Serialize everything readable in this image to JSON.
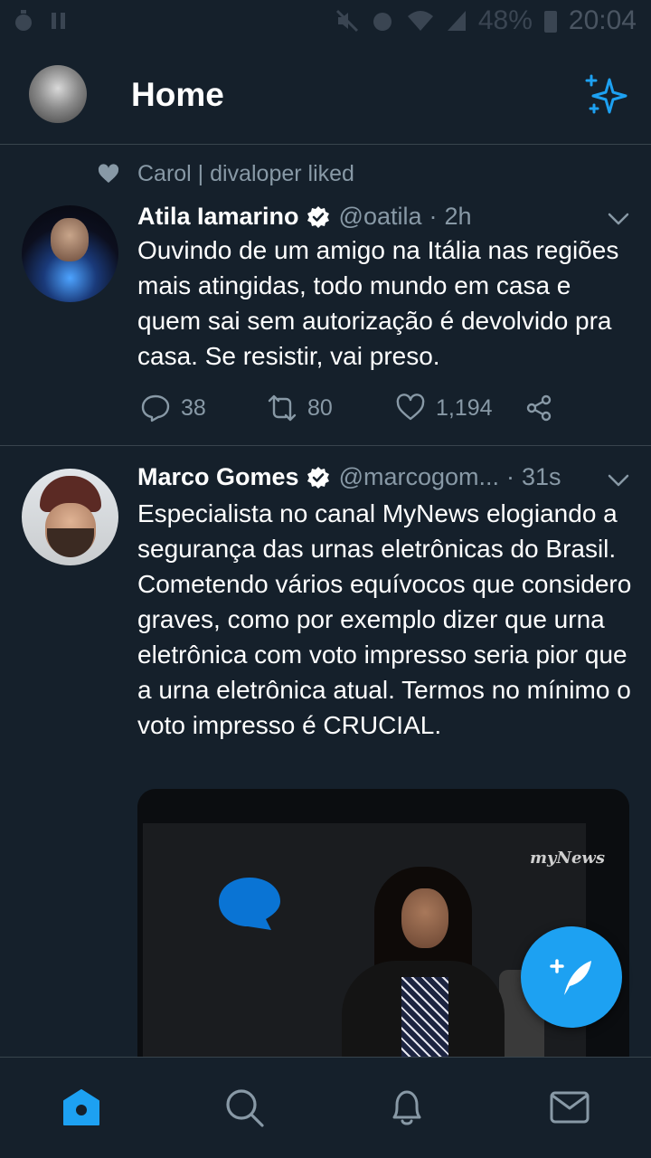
{
  "status_bar": {
    "battery": "48%",
    "time": "20:04"
  },
  "header": {
    "title": "Home",
    "icons": [
      "avatar",
      "sparkle-icon"
    ]
  },
  "tweets": [
    {
      "social_context": "Carol | divaloper liked",
      "name": "Atila Iamarino",
      "verified": true,
      "handle": "@oatila",
      "separator": "·",
      "time": "2h",
      "text": "Ouvindo de um amigo na Itália nas regiões mais atingidas, todo mundo em casa e quem sai sem autorização é devolvido pra casa. Se resistir, vai preso.",
      "reply_count": "38",
      "retweet_count": "80",
      "like_count": "1,194"
    },
    {
      "name": "Marco Gomes",
      "verified": true,
      "handle": "@marcogom...",
      "separator": "·",
      "time": "31s",
      "text": "Especialista no canal MyNews elogiando a segurança das urnas eletrônicas do Brasil. Cometendo vários equívocos que considero graves, como por exemplo dizer que urna eletrônica com voto impresso seria pior que a urna eletrônica atual. Termos no mínimo o voto impresso é CRUCIAL.",
      "media_logo": "myNews"
    }
  ],
  "colors": {
    "background": "#15202b",
    "accent": "#1da1f2",
    "secondary_text": "#8899a6",
    "divider": "#38444d"
  },
  "bottom_nav": [
    "home-icon",
    "search-icon",
    "notifications-icon",
    "messages-icon"
  ]
}
